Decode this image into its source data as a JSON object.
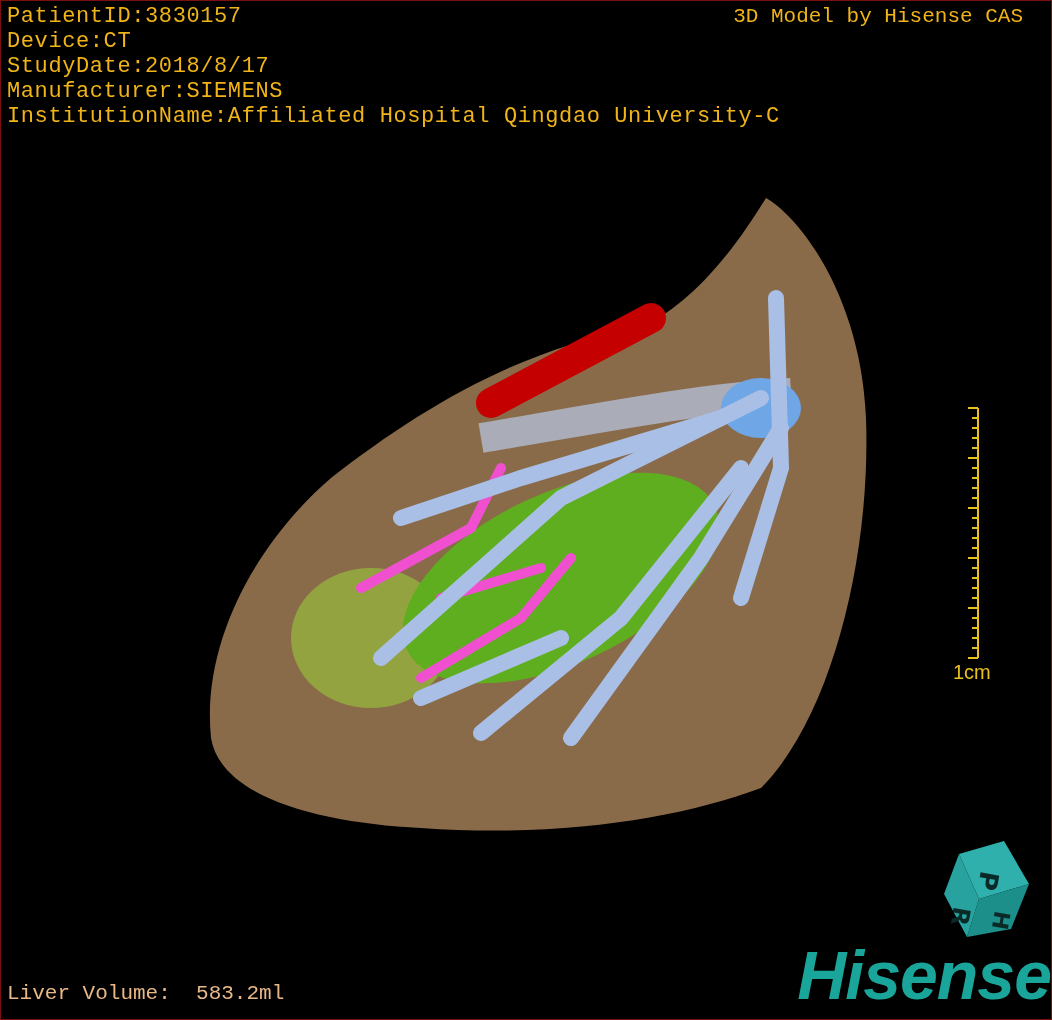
{
  "patient_info": [
    "PatientID:3830157",
    "Device:CT",
    "StudyDate:2018/8/17",
    "Manufacturer:SIEMENS",
    "InstitutionName:Affiliated Hospital Qingdao University-C"
  ],
  "credit": "3D Model by Hisense CAS",
  "scale_bar": {
    "label": "1cm"
  },
  "liver_volume": "Liver Volume:  583.2ml",
  "orientation_cube": {
    "faces": [
      "P",
      "R",
      "H"
    ]
  },
  "logo": "Hisense"
}
